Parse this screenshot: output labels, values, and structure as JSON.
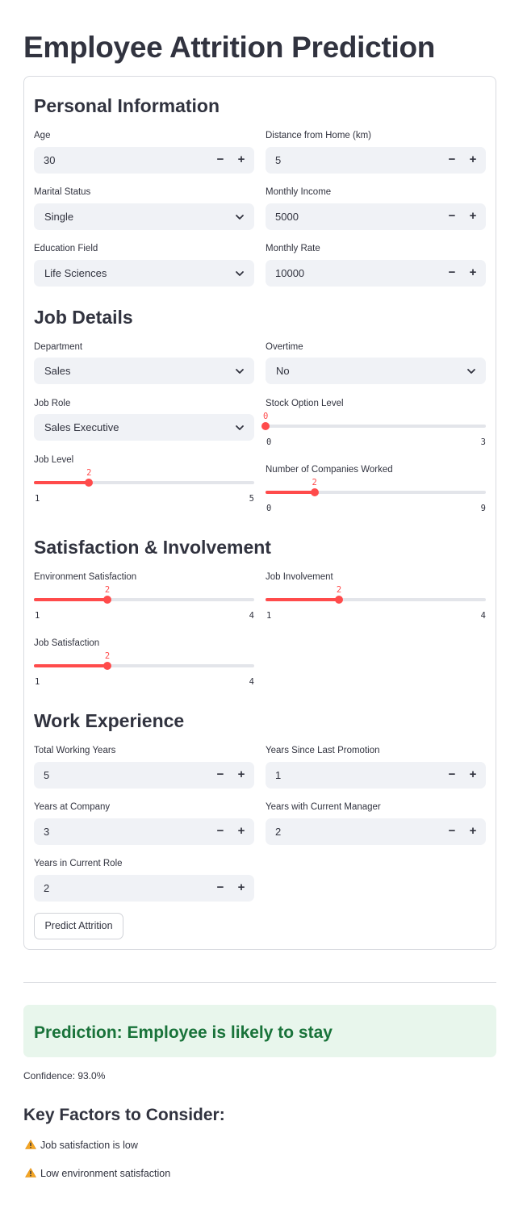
{
  "title": "Employee Attrition Prediction",
  "sections": {
    "personal": "Personal Information",
    "job": "Job Details",
    "satisfaction": "Satisfaction & Involvement",
    "experience": "Work Experience"
  },
  "personal": {
    "age": {
      "label": "Age",
      "value": "30"
    },
    "distance": {
      "label": "Distance from Home (km)",
      "value": "5"
    },
    "marital_status": {
      "label": "Marital Status",
      "value": "Single"
    },
    "monthly_income": {
      "label": "Monthly Income",
      "value": "5000"
    },
    "education_field": {
      "label": "Education Field",
      "value": "Life Sciences"
    },
    "monthly_rate": {
      "label": "Monthly Rate",
      "value": "10000"
    }
  },
  "job": {
    "department": {
      "label": "Department",
      "value": "Sales"
    },
    "overtime": {
      "label": "Overtime",
      "value": "No"
    },
    "job_role": {
      "label": "Job Role",
      "value": "Sales Executive"
    },
    "stock_option": {
      "label": "Stock Option Level",
      "value": "0",
      "min": "0",
      "max": "3"
    },
    "job_level": {
      "label": "Job Level",
      "value": "2",
      "min": "1",
      "max": "5"
    },
    "num_companies": {
      "label": "Number of Companies Worked",
      "value": "2",
      "min": "0",
      "max": "9"
    }
  },
  "satisfaction": {
    "environment": {
      "label": "Environment Satisfaction",
      "value": "2",
      "min": "1",
      "max": "4"
    },
    "involvement": {
      "label": "Job Involvement",
      "value": "2",
      "min": "1",
      "max": "4"
    },
    "job_satisfaction": {
      "label": "Job Satisfaction",
      "value": "2",
      "min": "1",
      "max": "4"
    }
  },
  "experience": {
    "total_years": {
      "label": "Total Working Years",
      "value": "5"
    },
    "since_promotion": {
      "label": "Years Since Last Promotion",
      "value": "1"
    },
    "at_company": {
      "label": "Years at Company",
      "value": "3"
    },
    "with_manager": {
      "label": "Years with Current Manager",
      "value": "2"
    },
    "in_role": {
      "label": "Years in Current Role",
      "value": "2"
    }
  },
  "stepper": {
    "minus": "−",
    "plus": "+"
  },
  "predict_button": "Predict Attrition",
  "result": {
    "prediction": "Prediction: Employee is likely to stay",
    "confidence": "Confidence: 93.0%"
  },
  "key_factors": {
    "title": "Key Factors to Consider:",
    "items": [
      "Job satisfaction is low",
      "Low environment satisfaction"
    ]
  },
  "icons": {
    "stepper_minus": "minus-icon",
    "stepper_plus": "plus-icon",
    "select_chevron": "chevron-down-icon",
    "warning": "warning-icon"
  },
  "colors": {
    "accent": "#ff4b4b",
    "input_bg": "#f0f2f6",
    "success_bg": "#e8f6ec",
    "success_text": "#19733a",
    "warning": "#f5a623"
  }
}
